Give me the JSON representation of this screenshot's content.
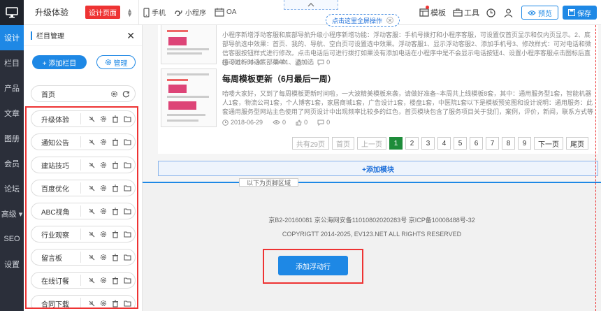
{
  "leftnav": {
    "items": [
      {
        "label": "设计",
        "active": true
      },
      {
        "label": "栏目",
        "active": false
      },
      {
        "label": "产品",
        "active": false
      },
      {
        "label": "文章",
        "active": false
      },
      {
        "label": "图册",
        "active": false
      },
      {
        "label": "会员",
        "active": false
      },
      {
        "label": "论坛",
        "active": false
      },
      {
        "label": "高级 ▾",
        "active": false
      },
      {
        "label": "SEO",
        "active": false
      },
      {
        "label": "设置",
        "active": false
      }
    ]
  },
  "topbar": {
    "page_name": "升级体验",
    "design_tag": "设计页面",
    "devices": [
      "手机",
      "小程序",
      "OA"
    ],
    "tooltip": "点击这里全屏操作",
    "template_label": "模板",
    "tools_label": "工具",
    "preview_label": "预览",
    "save_label": "保存"
  },
  "panel": {
    "title": "栏目管理",
    "add_label": "+ 添加栏目",
    "manage_label": "管理",
    "home_label": "首页",
    "columns": [
      "升级体验",
      "通知公告",
      "建站技巧",
      "百度优化",
      "ABC视角",
      "行业观察",
      "留言板",
      "在线订餐",
      "合同下载"
    ]
  },
  "preview": {
    "news": [
      {
        "title": "",
        "desc": "小程序新增浮动客服和底部导航升级小程序新增功能：浮动客服：手机号拨打和小程序客服，可设置仅首页显示和仅内页显示。2、底部导航选中效果：首页、我的、导航、空白页可设置选中效果。浮动客服1、显示浮动客服2、添加手机号3、修改样式：可对电话和微信客服按钮样式进行修改。点击电话后可进行拨打如果没有添加电话在小程序中是不会显示电话按钮4、设置小程序客服点击图标后直接可进行对话底部菜单1、添加选",
        "date": "2018-06-30",
        "views": "0",
        "likes": "0",
        "comments": "0"
      },
      {
        "title": "每周模板更新（6月最后一周）",
        "desc": "哈喽大家好，又到了每周模板更新时间啦，一大波精美模板来袭，请做好准备~本周共上线模板8套，其中：通用服务型1套，智能机器人1套，物流公司1套，个人博客1套，家居商城1套，广告设计1套，楼盘1套，中医院1套以下是模板预览图和设计说明：通用服务：此套通用服务型网站主色使用了网页设计中出现频率比较多的红色，首页模块包含了服务项目关于我们，案例，评价，新闻，联系方式等服务型所需要的所有模块，布局大气简",
        "date": "2018-06-29",
        "views": "0",
        "likes": "0",
        "comments": "0"
      }
    ],
    "pager": {
      "total": "共有29页",
      "first": "首页",
      "prev": "上一页",
      "pages": [
        "1",
        "2",
        "3",
        "4",
        "5",
        "6",
        "7",
        "8",
        "9"
      ],
      "current": "1",
      "next": "下一页",
      "last": "尾页"
    },
    "add_module": "+添加模块",
    "footer_label": "以下为页脚区域",
    "footer_line1": "京B2-20160081 京公海网安备11010802020283号 京ICP备10008488号-32",
    "footer_line2": "COPYRIGTT  2014-2025, EV123.NET ALL RIGHTS RESERVED",
    "float_btn": "添加浮动行"
  },
  "colors": {
    "accent": "#1e88e5",
    "highlight_red": "#e33",
    "pager_active": "#1e8c3a",
    "nav_bg": "#2b2f3a"
  }
}
